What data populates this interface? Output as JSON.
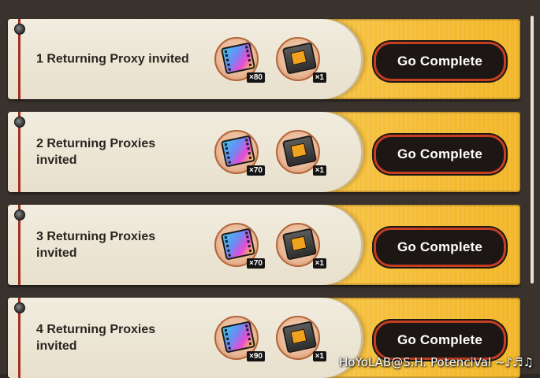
{
  "tasks": [
    {
      "title": "1 Returning Proxy invited",
      "rewards": [
        {
          "icon": "film-icon",
          "qty": "×80"
        },
        {
          "icon": "ticket-icon",
          "qty": "×1"
        }
      ],
      "button": "Go Complete"
    },
    {
      "title": "2 Returning Proxies invited",
      "rewards": [
        {
          "icon": "film-icon",
          "qty": "×70"
        },
        {
          "icon": "ticket-icon",
          "qty": "×1"
        }
      ],
      "button": "Go Complete"
    },
    {
      "title": "3 Returning Proxies invited",
      "rewards": [
        {
          "icon": "film-icon",
          "qty": "×70"
        },
        {
          "icon": "ticket-icon",
          "qty": "×1"
        }
      ],
      "button": "Go Complete"
    },
    {
      "title": "4 Returning Proxies invited",
      "rewards": [
        {
          "icon": "film-icon",
          "qty": "×90"
        },
        {
          "icon": "ticket-icon",
          "qty": "×1"
        }
      ],
      "button": "Go Complete"
    }
  ],
  "watermark": "HoYoLAB@S.H. PotenciVal ~♪♬♫",
  "colors": {
    "row_gold": "#f7c64a",
    "card": "#f1ecdf",
    "button_bg": "#1c1614",
    "button_border": "#c43f22",
    "accent_line": "#a1301f"
  }
}
